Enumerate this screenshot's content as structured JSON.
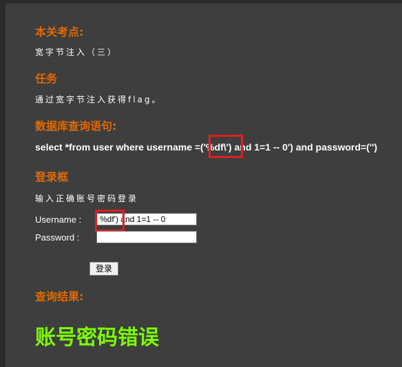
{
  "sections": {
    "key_point_heading": "本关考点:",
    "key_point_text": "宽字节注入（三）",
    "task_heading": "任务",
    "task_text": "通过宽字节注入获得flag。",
    "db_query_heading": "数据库查询语句:",
    "sql_query": "select *from user where username =('%df\\') and 1=1 -- 0') and password=('')",
    "login_heading": "登录框",
    "login_hint": "输入正确账号密码登录",
    "username_label": "Username :",
    "username_value": "%df') and 1=1  -- 0",
    "password_label": "Password :",
    "password_value": "",
    "submit_label": "登录",
    "result_heading": "查询结果:",
    "result_text": "账号密码错误"
  },
  "colors": {
    "background": "#3e3e3e",
    "heading": "#e06a00",
    "result": "#7cfc00",
    "highlight": "#e02020"
  }
}
